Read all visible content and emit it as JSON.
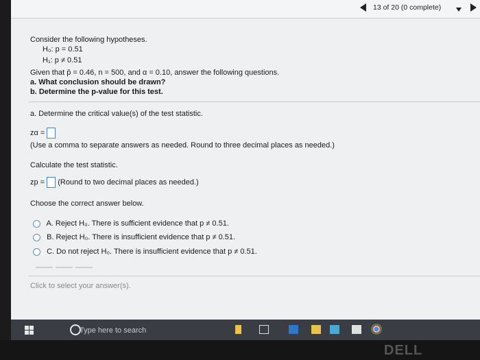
{
  "header": {
    "progress": "13 of 20 (0 complete)"
  },
  "question": {
    "intro": "Consider the following hypotheses.",
    "h0": "H₀: p = 0.51",
    "h1": "H₁: p ≠ 0.51",
    "given": "Given that p̄ = 0.46, n = 500, and α = 0.10, answer the following questions.",
    "part_a": "a. What conclusion should be drawn?",
    "part_b": "b. Determine the p-value for this test."
  },
  "section_a": {
    "heading": "a. Determine the critical value(s) of the test statistic.",
    "z_alpha_label": "zα =",
    "hint1": "(Use a comma to separate answers as needed. Round to three decimal places as needed.)",
    "calc_label": "Calculate the test statistic.",
    "zp_label": "zp =",
    "hint2": "(Round to two decimal places as needed.)",
    "choose_label": "Choose the correct answer below."
  },
  "options": [
    {
      "letter": "A.",
      "text": "Reject H₀. There is sufficient evidence that p ≠ 0.51."
    },
    {
      "letter": "B.",
      "text": "Reject H₀. There is insufficient evidence that p ≠ 0.51."
    },
    {
      "letter": "C.",
      "text": "Do not reject H₀. There is insufficient evidence that p ≠ 0.51."
    }
  ],
  "footer": {
    "click_prompt": "Click to select your answer(s)."
  },
  "taskbar": {
    "search_placeholder": "Type here to search"
  },
  "bezel": {
    "brand": "DELL"
  }
}
